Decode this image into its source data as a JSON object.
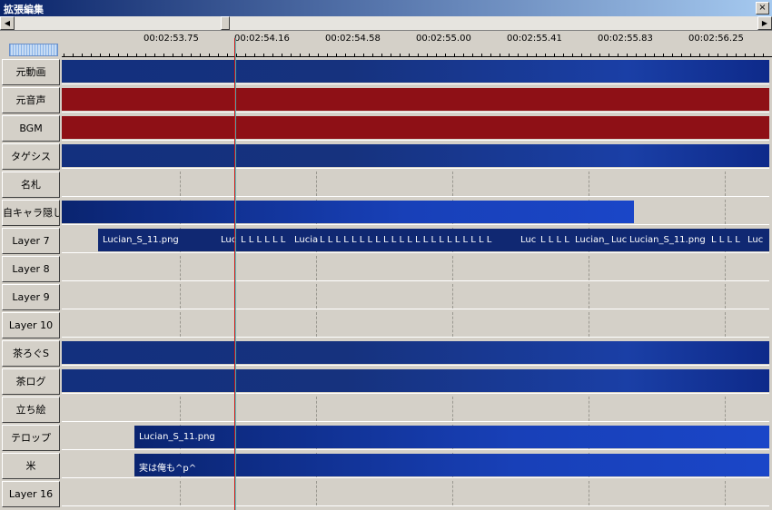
{
  "window": {
    "title": "拡張編集",
    "close_label": "×"
  },
  "scrollbar": {
    "left_arrow": "◀",
    "right_arrow": "▶"
  },
  "ruler": {
    "timecodes": [
      "00:02:53.75",
      "00:02:54.16",
      "00:02:54.58",
      "00:02:55.00",
      "00:02:55.41",
      "00:02:55.83",
      "00:02:56.25"
    ]
  },
  "layers": [
    {
      "label": "元動画"
    },
    {
      "label": "元音声"
    },
    {
      "label": "BGM"
    },
    {
      "label": "タゲシス"
    },
    {
      "label": "名札"
    },
    {
      "label": "自キャラ隠し"
    },
    {
      "label": "Layer  7"
    },
    {
      "label": "Layer  8"
    },
    {
      "label": "Layer  9"
    },
    {
      "label": "Layer 10"
    },
    {
      "label": "茶ろぐS"
    },
    {
      "label": "茶ログ"
    },
    {
      "label": "立ち絵"
    },
    {
      "label": "テロップ"
    },
    {
      "label": "米"
    },
    {
      "label": "Layer 16"
    }
  ],
  "clips": {
    "layer7_first": "Lucian_S_11.png",
    "layer7_tail_a": "Luc",
    "layer7_tail_b": "L L L L L L",
    "layer7_mid_a": "Lucia",
    "layer7_mid_b": "L L L L L L L L L L L L L L L L L L L L L L",
    "layer7_mid_c": "Luc",
    "layer7_mid_d": "L L L L",
    "layer7_late_a": "Lucian_",
    "layer7_late_b": "Luc",
    "layer7_late_c": "Lucian_S_11.png",
    "layer7_late_d": "L L L L",
    "layer7_late_e": "Luc",
    "telop": "Lucian_S_11.png",
    "kome": "実は俺も^p^"
  },
  "colors": {
    "video": "#13307e",
    "audio": "#8e1016",
    "cursor_red": "#d01010",
    "cursor_cyan": "#40c8c8"
  }
}
